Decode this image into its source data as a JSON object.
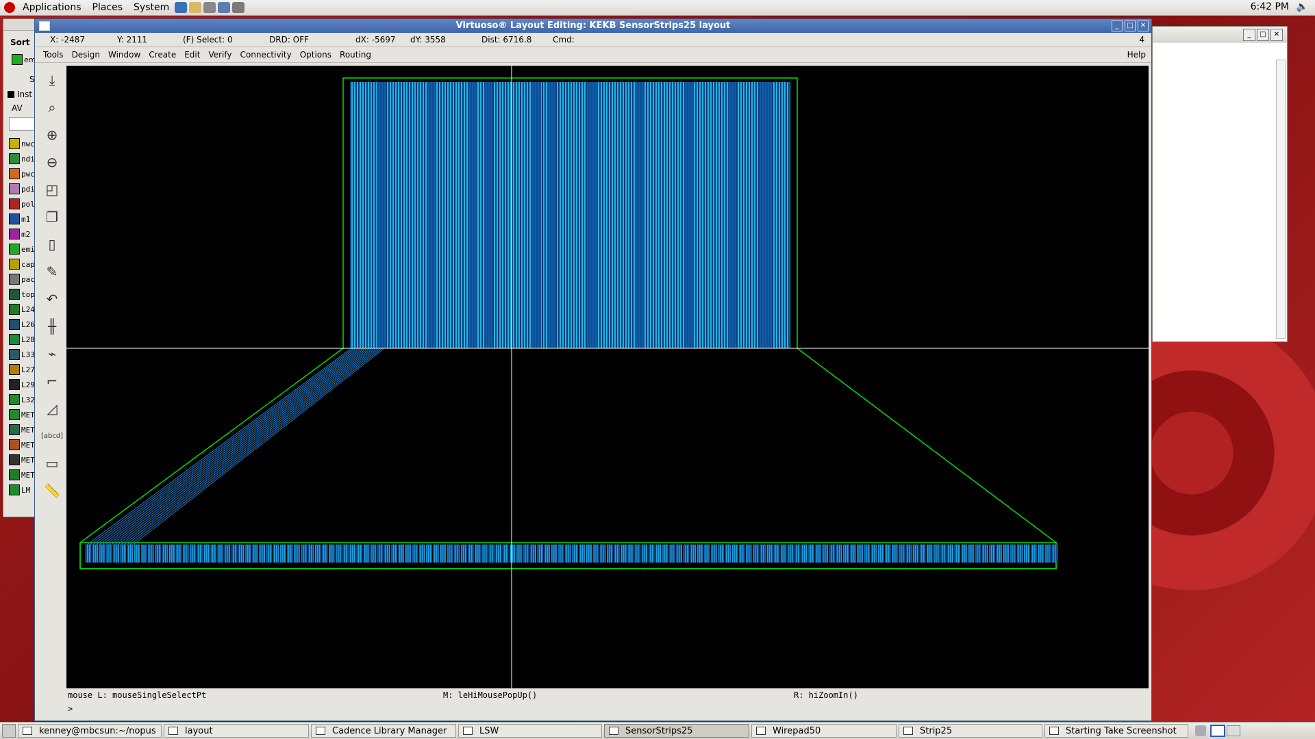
{
  "top_panel": {
    "applications": "Applications",
    "places": "Places",
    "system": "System",
    "clock": "6:42 PM"
  },
  "main_window": {
    "title": "Virtuoso® Layout Editing: KEKB SensorStrips25 layout",
    "status": {
      "x": "X: -2487",
      "y": "Y: 2111",
      "select": "(F) Select: 0",
      "drd": "DRD: OFF",
      "dx": "dX: -5697",
      "dy": "dY: 3558",
      "dist": "Dist: 6716.8",
      "cmd": "Cmd:",
      "num": "4"
    },
    "menu": [
      "Tools",
      "Design",
      "Window",
      "Create",
      "Edit",
      "Verify",
      "Connectivity",
      "Options",
      "Routing"
    ],
    "help": "Help",
    "hints": {
      "left": "mouse L: mouseSingleSelectPt",
      "middle": "M: leHiMousePopUp()",
      "right": "R: hiZoomIn()"
    },
    "prompt": ">"
  },
  "tools": [
    {
      "name": "save-icon",
      "glyph": "⤓"
    },
    {
      "name": "zoom-fit-icon",
      "glyph": "⌕"
    },
    {
      "name": "zoom-in-icon",
      "glyph": "⊕"
    },
    {
      "name": "zoom-out-icon",
      "glyph": "⊖"
    },
    {
      "name": "stretch-icon",
      "glyph": "◰"
    },
    {
      "name": "copy-icon",
      "glyph": "❐"
    },
    {
      "name": "move-icon",
      "glyph": "▯"
    },
    {
      "name": "ruler-pencil-icon",
      "glyph": "✎"
    },
    {
      "name": "undo-icon",
      "glyph": "↶"
    },
    {
      "name": "path-icon",
      "glyph": "╫"
    },
    {
      "name": "wire-icon",
      "glyph": "⌁"
    },
    {
      "name": "polygon-icon",
      "glyph": "⌐"
    },
    {
      "name": "instance-icon",
      "glyph": "◿"
    },
    {
      "name": "label-icon",
      "glyph": "[abcd]"
    },
    {
      "name": "rectangle-icon",
      "glyph": "▭"
    },
    {
      "name": "ruler-icon",
      "glyph": "📏"
    }
  ],
  "lsw": {
    "sort": "Sort",
    "current": "em",
    "s_label": "S",
    "inst": "Inst",
    "av": "AV",
    "layers": [
      {
        "name": "nwc",
        "color": "#c8b400"
      },
      {
        "name": "ndi",
        "color": "#2e8b3d"
      },
      {
        "name": "pwc",
        "color": "#d2691e"
      },
      {
        "name": "pdi",
        "color": "#b07ab0"
      },
      {
        "name": "pol",
        "color": "#b22222"
      },
      {
        "name": "m1",
        "color": "#2050a0"
      },
      {
        "name": "m2",
        "color": "#a020a0"
      },
      {
        "name": "emi",
        "color": "#22aa22"
      },
      {
        "name": "cap",
        "color": "#b8a000"
      },
      {
        "name": "pac",
        "color": "#777777"
      },
      {
        "name": "top",
        "color": "#1a5a3a"
      },
      {
        "name": "L24",
        "color": "#1f7a2a"
      },
      {
        "name": "L26",
        "color": "#205070"
      },
      {
        "name": "L28",
        "color": "#1f8a3a"
      },
      {
        "name": "L33",
        "color": "#2a5a6a"
      },
      {
        "name": "L27",
        "color": "#b08000"
      },
      {
        "name": "L29",
        "color": "#222222"
      },
      {
        "name": "L32",
        "color": "#1f8a2a"
      },
      {
        "name": "MET",
        "color": "#1f8a2a"
      },
      {
        "name": "MET",
        "color": "#2a6a4a"
      },
      {
        "name": "MET",
        "color": "#b0501e"
      },
      {
        "name": "MET",
        "color": "#333333"
      },
      {
        "name": "MET",
        "color": "#1f7a2a"
      },
      {
        "name": "LM",
        "color": "#1f8a2a"
      }
    ]
  },
  "taskbar": [
    {
      "label": "kenney@mbcsun:~/nopus",
      "active": false
    },
    {
      "label": "layout",
      "active": false
    },
    {
      "label": "Cadence Library Manager",
      "active": false
    },
    {
      "label": "LSW",
      "active": false
    },
    {
      "label": "SensorStrips25",
      "active": true
    },
    {
      "label": "Wirepad50",
      "active": false
    },
    {
      "label": "Strip25",
      "active": false
    },
    {
      "label": "Starting Take Screenshot",
      "active": false
    }
  ],
  "colors": {
    "strip": "#1fb0e0",
    "strip_dark": "#0d4f9a",
    "boundary": "#00e000",
    "canvas": "#000000"
  }
}
